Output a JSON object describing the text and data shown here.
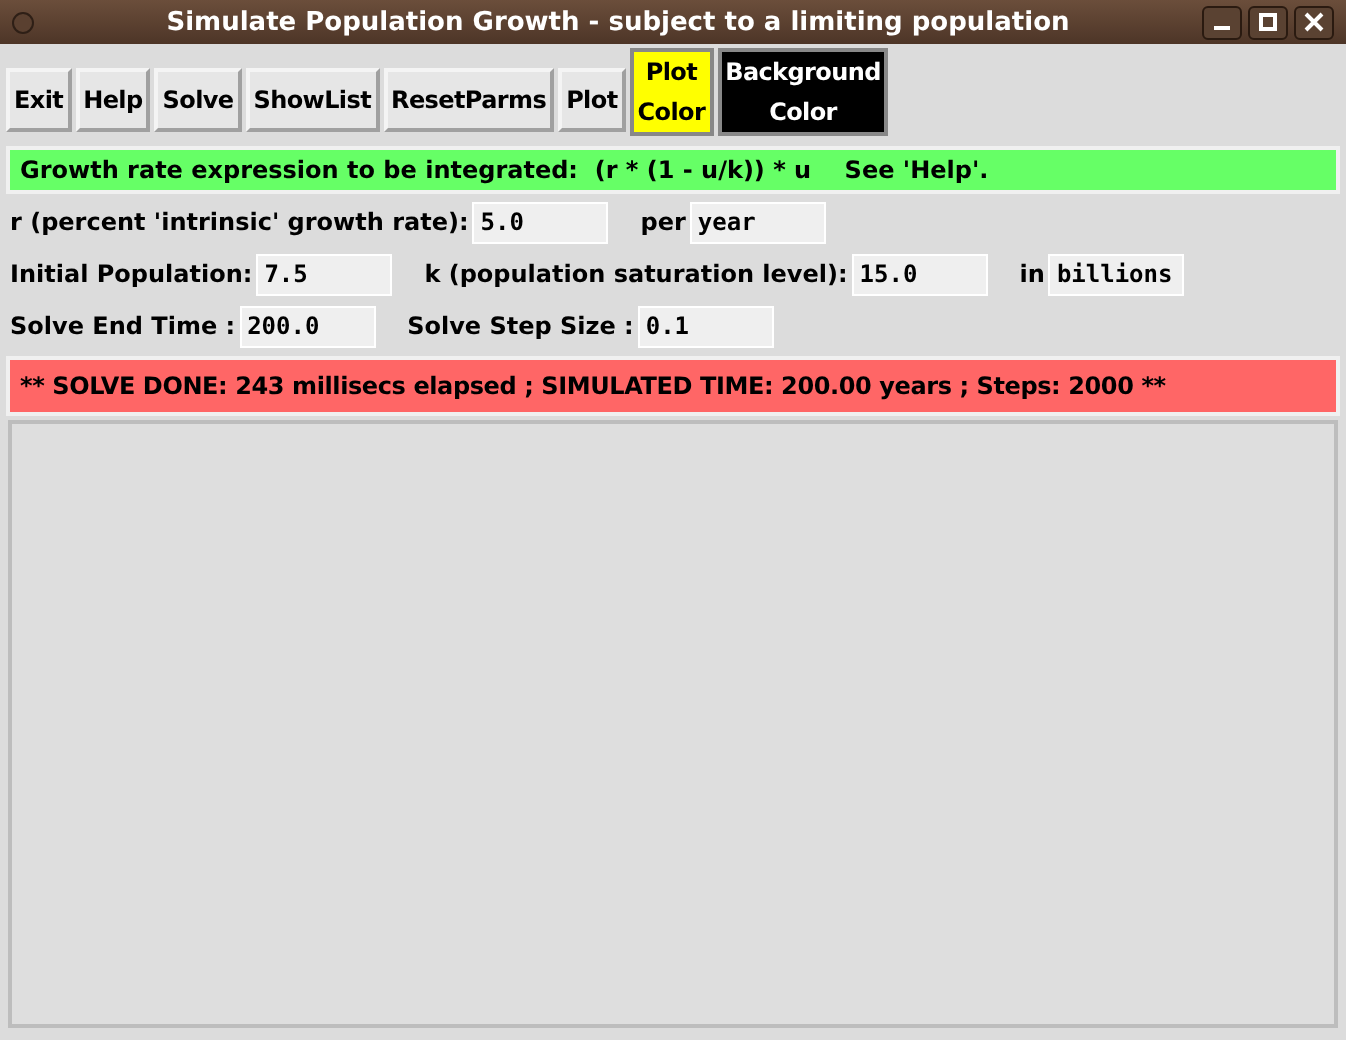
{
  "window": {
    "title": "Simulate Population Growth - subject to a limiting population"
  },
  "buttons": [
    {
      "label": "Exit",
      "kind": "plain"
    },
    {
      "label": "Help",
      "kind": "plain"
    },
    {
      "label": "Solve",
      "kind": "plain"
    },
    {
      "label": "ShowList",
      "kind": "plain"
    },
    {
      "label": "ResetParms",
      "kind": "plain"
    },
    {
      "label": "Plot",
      "kind": "plain"
    },
    {
      "label": "Plot\nColor",
      "kind": "swatch",
      "color": "#ffff00"
    },
    {
      "label": "Background\nColor",
      "kind": "swatch",
      "color": "#000000"
    }
  ],
  "expression_bar": {
    "text": "Growth rate expression to be integrated:  (r * (1 - u/k)) * u    See 'Help'."
  },
  "rows": [
    [
      {
        "kind": "label",
        "text": "r (percent 'intrinsic' growth rate):"
      },
      {
        "kind": "entry",
        "value": "5.0"
      },
      {
        "kind": "label",
        "text": "per"
      },
      {
        "kind": "entry",
        "value": "year"
      }
    ],
    [
      {
        "kind": "label",
        "text": "Initial Population:"
      },
      {
        "kind": "entry",
        "value": "7.5"
      },
      {
        "kind": "label",
        "text": "k (population saturation level):"
      },
      {
        "kind": "entry",
        "value": "15.0"
      },
      {
        "kind": "label",
        "text": "in"
      },
      {
        "kind": "entry",
        "value": "billions"
      }
    ],
    [
      {
        "kind": "label",
        "text": "Solve End Time :"
      },
      {
        "kind": "entry",
        "value": "200.0"
      },
      {
        "kind": "label",
        "text": "Solve Step Size :"
      },
      {
        "kind": "entry",
        "value": "0.1"
      }
    ]
  ],
  "status_bar": {
    "text": "** SOLVE DONE: 243 millisecs elapsed ; SIMULATED TIME: 200.00 years ; Steps: 2000 **"
  }
}
